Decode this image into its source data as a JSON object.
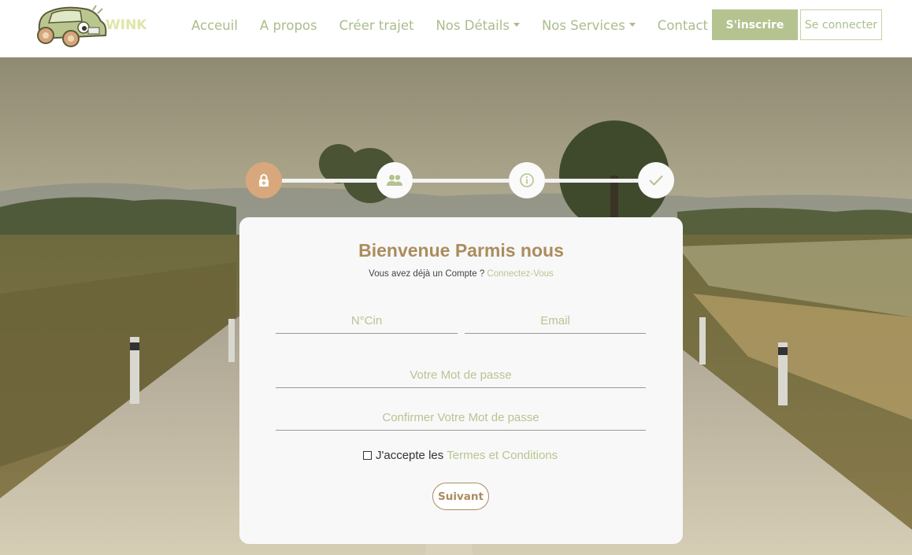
{
  "brand": {
    "name": "WINK"
  },
  "nav": {
    "items": [
      {
        "label": "Acceuil",
        "dropdown": false
      },
      {
        "label": "A propos",
        "dropdown": false
      },
      {
        "label": "Créer trajet",
        "dropdown": false
      },
      {
        "label": "Nos Détails",
        "dropdown": true
      },
      {
        "label": "Nos Services",
        "dropdown": true
      },
      {
        "label": "Contact",
        "dropdown": true
      }
    ],
    "signup_label": "S'inscrire",
    "login_label": "Se connecter"
  },
  "stepper": {
    "steps": [
      {
        "icon": "lock-icon",
        "active": true
      },
      {
        "icon": "users-icon",
        "active": false
      },
      {
        "icon": "info-icon",
        "active": false
      },
      {
        "icon": "check-icon",
        "active": false
      }
    ]
  },
  "form": {
    "title": "Bienvenue Parmis nous",
    "subtitle": "Vous avez déjà un Compte ?",
    "subtitle_link": "Connectez-Vous",
    "cin_placeholder": "N°Cin",
    "email_placeholder": "Email",
    "password_placeholder": "Votre Mot de passe",
    "confirm_placeholder": "Confirmer Votre Mot de passe",
    "terms_prefix": "J'accepte les",
    "terms_link": "Termes et Conditions",
    "next_label": "Suivant"
  },
  "colors": {
    "accent_green": "#b4c38f",
    "accent_brown": "#ab8c5e",
    "step_active": "#d8a87c"
  }
}
